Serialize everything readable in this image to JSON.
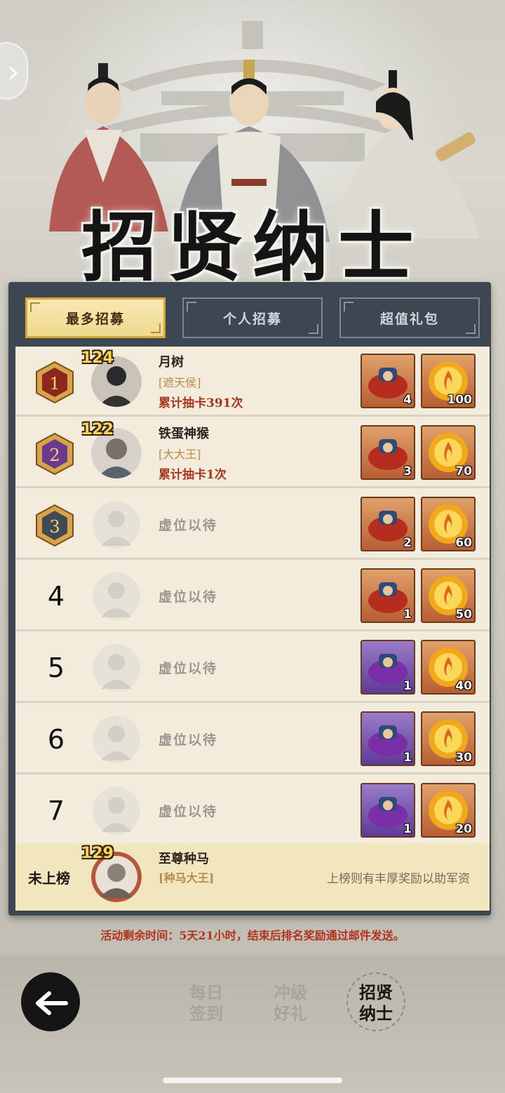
{
  "banner": {
    "title": "招贤纳士"
  },
  "tabs": [
    {
      "label": "最多招募",
      "active": true
    },
    {
      "label": "个人招募",
      "active": false
    },
    {
      "label": "超值礼包",
      "active": false
    }
  ],
  "ranking": [
    {
      "rank": "1",
      "level": "124",
      "name": "月树",
      "title": "[遮天侯]",
      "count": "累计抽卡391次",
      "rewards": [
        "4",
        "100"
      ]
    },
    {
      "rank": "2",
      "level": "122",
      "name": "铁蛋神猴",
      "title": "[大大王]",
      "count": "累计抽卡1次",
      "rewards": [
        "3",
        "70"
      ]
    },
    {
      "rank": "3",
      "vacant": "虚位以待",
      "rewards": [
        "2",
        "60"
      ]
    },
    {
      "rank": "4",
      "vacant": "虚位以待",
      "rewards": [
        "1",
        "50"
      ]
    },
    {
      "rank": "5",
      "vacant": "虚位以待",
      "rewards": [
        "1",
        "40"
      ]
    },
    {
      "rank": "6",
      "vacant": "虚位以待",
      "rewards": [
        "1",
        "30"
      ]
    },
    {
      "rank": "7",
      "vacant": "虚位以待",
      "rewards": [
        "1",
        "20"
      ]
    }
  ],
  "self": {
    "status": "未上榜",
    "level": "129",
    "name": "至尊种马",
    "title": "[种马大王]",
    "note": "上榜则有丰厚奖励以助军资"
  },
  "footer_note": "活动剩余时间：5天21小时，结束后排名奖励通过邮件发送。",
  "bottom_nav": [
    {
      "line1": "每日",
      "line2": "签到",
      "active": false
    },
    {
      "line1": "冲级",
      "line2": "好礼",
      "active": false
    },
    {
      "line1": "招贤",
      "line2": "纳士",
      "active": true
    }
  ],
  "colors": {
    "panel": "#3c4751",
    "list_bg": "#f3ebdb",
    "active_tab": "#efd98e",
    "count_red": "#a8361f",
    "title_gold": "#b98a4a"
  },
  "icons": {
    "back": "back-arrow-icon",
    "side": "chevron-right-icon",
    "reward1": "general-chest-icon",
    "reward2": "fire-orb-icon"
  }
}
